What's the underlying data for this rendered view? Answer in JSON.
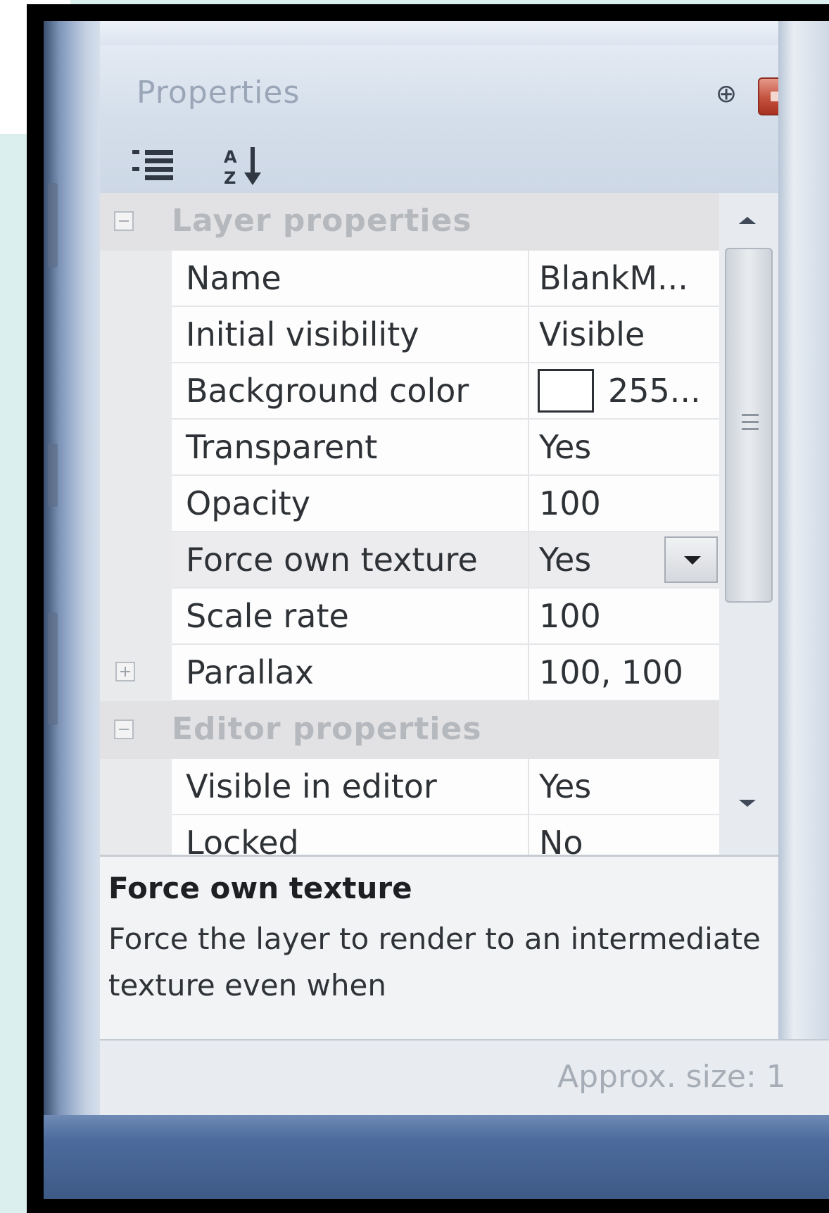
{
  "window": {
    "title": "Properties",
    "pin_glyph": "⊕",
    "close_icon": "close-icon"
  },
  "toolbar": {
    "categorized_icon": "categorized-list-icon",
    "alphabetical_icon": "sort-az-icon"
  },
  "categories": [
    {
      "label": "Layer properties",
      "expanded": true,
      "properties": [
        {
          "name": "Name",
          "value": "BlankM..."
        },
        {
          "name": "Initial visibility",
          "value": "Visible"
        },
        {
          "name": "Background color",
          "value": "255...",
          "swatch_color": "#ffffff"
        },
        {
          "name": "Transparent",
          "value": "Yes"
        },
        {
          "name": "Opacity",
          "value": "100"
        },
        {
          "name": "Force own texture",
          "value": "Yes",
          "selected": true,
          "has_dropdown": true
        },
        {
          "name": "Scale rate",
          "value": "100"
        },
        {
          "name": "Parallax",
          "value": "100, 100",
          "expandable": true
        }
      ]
    },
    {
      "label": "Editor properties",
      "expanded": true,
      "properties": [
        {
          "name": "Visible in editor",
          "value": "Yes"
        },
        {
          "name": "Locked",
          "value": "No"
        }
      ]
    }
  ],
  "help": {
    "title": "Force own texture",
    "text": "Force the layer to render to an intermediate texture even when"
  },
  "status": {
    "text": "Approx. size: 1"
  },
  "colors": {
    "close_button": "#c4513e",
    "title_text": "#9aa6b8",
    "selected_row": "#ececee"
  }
}
